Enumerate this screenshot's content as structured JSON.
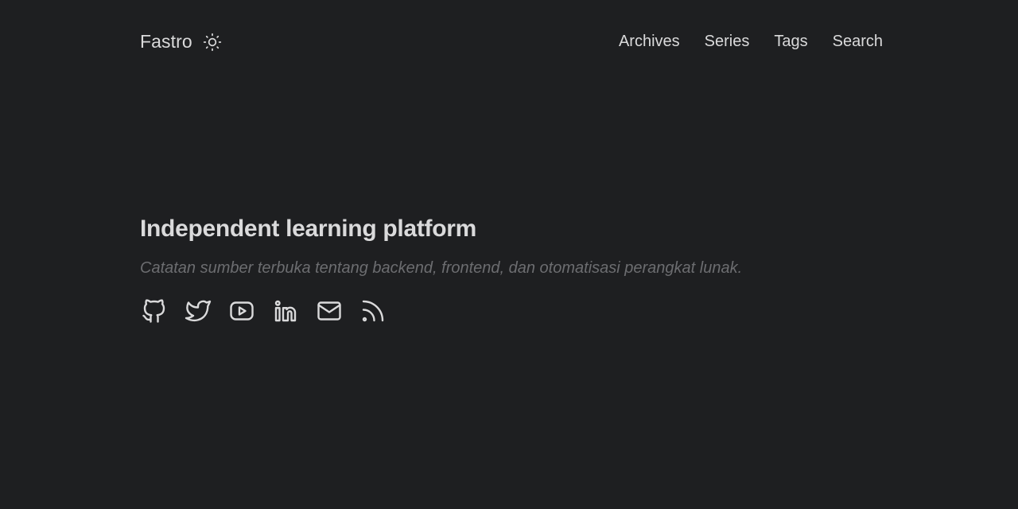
{
  "header": {
    "logo": "Fastro",
    "theme_toggle_icon": "sun-icon",
    "nav": [
      {
        "label": "Archives"
      },
      {
        "label": "Series"
      },
      {
        "label": "Tags"
      },
      {
        "label": "Search"
      }
    ]
  },
  "hero": {
    "title": "Independent learning platform",
    "subtitle": "Catatan sumber terbuka tentang backend, frontend, dan otomatisasi perangkat lunak."
  },
  "social": [
    {
      "icon": "github-icon"
    },
    {
      "icon": "twitter-icon"
    },
    {
      "icon": "youtube-icon"
    },
    {
      "icon": "linkedin-icon"
    },
    {
      "icon": "mail-icon"
    },
    {
      "icon": "rss-icon"
    }
  ],
  "colors": {
    "background": "#1e1f21",
    "text": "#dadadb",
    "muted": "#6c6d70"
  }
}
